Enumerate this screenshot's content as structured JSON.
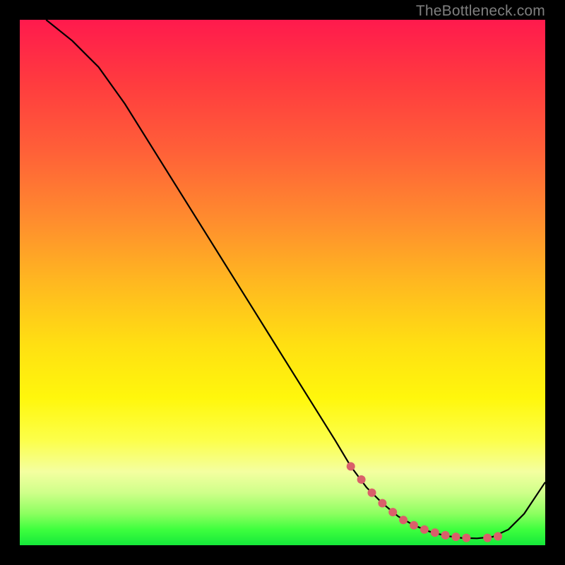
{
  "watermark": "TheBottleneck.com",
  "chart_data": {
    "type": "line",
    "title": "",
    "xlabel": "",
    "ylabel": "",
    "xlim": [
      0,
      100
    ],
    "ylim": [
      0,
      100
    ],
    "grid": false,
    "series": [
      {
        "name": "curve",
        "color": "#000000",
        "x": [
          5,
          10,
          15,
          20,
          25,
          30,
          35,
          40,
          45,
          50,
          55,
          60,
          63,
          66,
          69,
          72,
          75,
          78,
          81,
          84,
          87,
          90,
          93,
          96,
          100
        ],
        "y": [
          100,
          96,
          91,
          84,
          76,
          68,
          60,
          52,
          44,
          36,
          28,
          20,
          15,
          11,
          8,
          5.5,
          3.8,
          2.6,
          1.8,
          1.4,
          1.3,
          1.6,
          3.0,
          6.0,
          12
        ]
      }
    ],
    "markers": {
      "name": "highlight-dots",
      "color": "#d9606a",
      "radius_px": 6,
      "x": [
        63,
        65,
        67,
        69,
        71,
        73,
        75,
        77,
        79,
        81,
        83,
        85,
        89,
        91
      ],
      "y": [
        15,
        12.5,
        10,
        8,
        6.3,
        4.8,
        3.8,
        3.0,
        2.4,
        1.9,
        1.6,
        1.4,
        1.4,
        1.7
      ]
    }
  }
}
